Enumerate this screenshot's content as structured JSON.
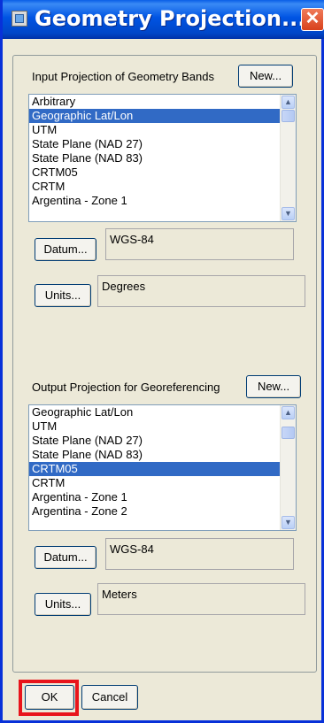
{
  "window": {
    "title": "Geometry Projection..."
  },
  "input_section": {
    "label": "Input Projection of Geometry Bands",
    "new_label": "New...",
    "items": [
      "Arbitrary",
      "Geographic Lat/Lon",
      "UTM",
      "State Plane (NAD 27)",
      "State Plane (NAD 83)",
      "CRTM05",
      "CRTM",
      "Argentina - Zone 1"
    ],
    "selected": "Geographic Lat/Lon",
    "datum_label": "Datum...",
    "datum_value": "WGS-84",
    "units_label": "Units...",
    "units_value": "Degrees"
  },
  "output_section": {
    "label": "Output Projection for Georeferencing",
    "new_label": "New...",
    "items": [
      "Geographic Lat/Lon",
      "UTM",
      "State Plane (NAD 27)",
      "State Plane (NAD 83)",
      "CRTM05",
      "CRTM",
      "Argentina - Zone 1",
      "Argentina - Zone 2"
    ],
    "selected": "CRTM05",
    "datum_label": "Datum...",
    "datum_value": "WGS-84",
    "units_label": "Units...",
    "units_value": "Meters"
  },
  "buttons": {
    "ok_label": "OK",
    "cancel_label": "Cancel"
  },
  "colors": {
    "titlebar": "#0054e3",
    "selection": "#316ac5",
    "highlight": "#e8141b",
    "dialog_bg": "#ece9d8"
  },
  "icons": {
    "app": "window-app-icon",
    "close": "close-icon",
    "scroll_up": "scroll-up-arrow-icon",
    "scroll_down": "scroll-down-arrow-icon"
  }
}
